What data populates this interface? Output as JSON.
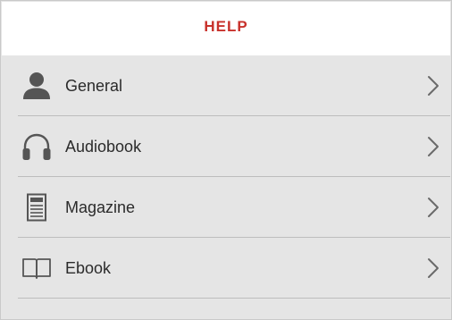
{
  "header": {
    "title": "HELP",
    "title_color": "#c8312b"
  },
  "items": [
    {
      "label": "General",
      "icon": "person-icon"
    },
    {
      "label": "Audiobook",
      "icon": "headphones-icon"
    },
    {
      "label": "Magazine",
      "icon": "magazine-icon"
    },
    {
      "label": "Ebook",
      "icon": "open-book-icon"
    }
  ],
  "colors": {
    "background": "#e5e5e5",
    "text": "#2b2b2b",
    "icon": "#555555",
    "divider": "#bdbdbd"
  }
}
